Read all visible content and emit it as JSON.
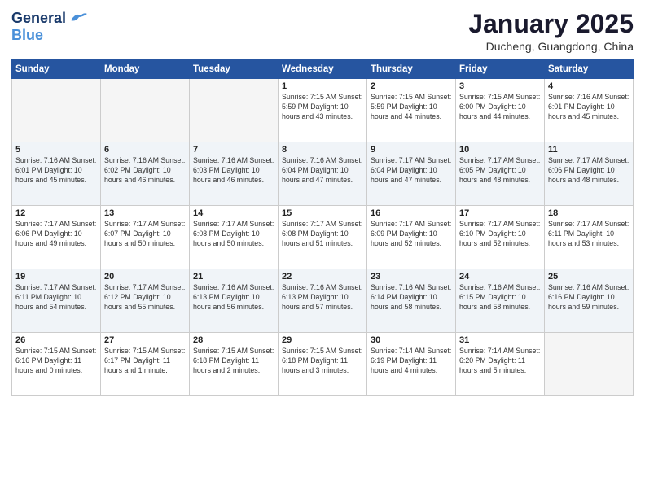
{
  "logo": {
    "line1": "General",
    "line2": "Blue"
  },
  "header": {
    "month": "January 2025",
    "location": "Ducheng, Guangdong, China"
  },
  "weekdays": [
    "Sunday",
    "Monday",
    "Tuesday",
    "Wednesday",
    "Thursday",
    "Friday",
    "Saturday"
  ],
  "weeks": [
    [
      {
        "day": "",
        "content": ""
      },
      {
        "day": "",
        "content": ""
      },
      {
        "day": "",
        "content": ""
      },
      {
        "day": "1",
        "content": "Sunrise: 7:15 AM\nSunset: 5:59 PM\nDaylight: 10 hours\nand 43 minutes."
      },
      {
        "day": "2",
        "content": "Sunrise: 7:15 AM\nSunset: 5:59 PM\nDaylight: 10 hours\nand 44 minutes."
      },
      {
        "day": "3",
        "content": "Sunrise: 7:15 AM\nSunset: 6:00 PM\nDaylight: 10 hours\nand 44 minutes."
      },
      {
        "day": "4",
        "content": "Sunrise: 7:16 AM\nSunset: 6:01 PM\nDaylight: 10 hours\nand 45 minutes."
      }
    ],
    [
      {
        "day": "5",
        "content": "Sunrise: 7:16 AM\nSunset: 6:01 PM\nDaylight: 10 hours\nand 45 minutes."
      },
      {
        "day": "6",
        "content": "Sunrise: 7:16 AM\nSunset: 6:02 PM\nDaylight: 10 hours\nand 46 minutes."
      },
      {
        "day": "7",
        "content": "Sunrise: 7:16 AM\nSunset: 6:03 PM\nDaylight: 10 hours\nand 46 minutes."
      },
      {
        "day": "8",
        "content": "Sunrise: 7:16 AM\nSunset: 6:04 PM\nDaylight: 10 hours\nand 47 minutes."
      },
      {
        "day": "9",
        "content": "Sunrise: 7:17 AM\nSunset: 6:04 PM\nDaylight: 10 hours\nand 47 minutes."
      },
      {
        "day": "10",
        "content": "Sunrise: 7:17 AM\nSunset: 6:05 PM\nDaylight: 10 hours\nand 48 minutes."
      },
      {
        "day": "11",
        "content": "Sunrise: 7:17 AM\nSunset: 6:06 PM\nDaylight: 10 hours\nand 48 minutes."
      }
    ],
    [
      {
        "day": "12",
        "content": "Sunrise: 7:17 AM\nSunset: 6:06 PM\nDaylight: 10 hours\nand 49 minutes."
      },
      {
        "day": "13",
        "content": "Sunrise: 7:17 AM\nSunset: 6:07 PM\nDaylight: 10 hours\nand 50 minutes."
      },
      {
        "day": "14",
        "content": "Sunrise: 7:17 AM\nSunset: 6:08 PM\nDaylight: 10 hours\nand 50 minutes."
      },
      {
        "day": "15",
        "content": "Sunrise: 7:17 AM\nSunset: 6:08 PM\nDaylight: 10 hours\nand 51 minutes."
      },
      {
        "day": "16",
        "content": "Sunrise: 7:17 AM\nSunset: 6:09 PM\nDaylight: 10 hours\nand 52 minutes."
      },
      {
        "day": "17",
        "content": "Sunrise: 7:17 AM\nSunset: 6:10 PM\nDaylight: 10 hours\nand 52 minutes."
      },
      {
        "day": "18",
        "content": "Sunrise: 7:17 AM\nSunset: 6:11 PM\nDaylight: 10 hours\nand 53 minutes."
      }
    ],
    [
      {
        "day": "19",
        "content": "Sunrise: 7:17 AM\nSunset: 6:11 PM\nDaylight: 10 hours\nand 54 minutes."
      },
      {
        "day": "20",
        "content": "Sunrise: 7:17 AM\nSunset: 6:12 PM\nDaylight: 10 hours\nand 55 minutes."
      },
      {
        "day": "21",
        "content": "Sunrise: 7:16 AM\nSunset: 6:13 PM\nDaylight: 10 hours\nand 56 minutes."
      },
      {
        "day": "22",
        "content": "Sunrise: 7:16 AM\nSunset: 6:13 PM\nDaylight: 10 hours\nand 57 minutes."
      },
      {
        "day": "23",
        "content": "Sunrise: 7:16 AM\nSunset: 6:14 PM\nDaylight: 10 hours\nand 58 minutes."
      },
      {
        "day": "24",
        "content": "Sunrise: 7:16 AM\nSunset: 6:15 PM\nDaylight: 10 hours\nand 58 minutes."
      },
      {
        "day": "25",
        "content": "Sunrise: 7:16 AM\nSunset: 6:16 PM\nDaylight: 10 hours\nand 59 minutes."
      }
    ],
    [
      {
        "day": "26",
        "content": "Sunrise: 7:15 AM\nSunset: 6:16 PM\nDaylight: 11 hours\nand 0 minutes."
      },
      {
        "day": "27",
        "content": "Sunrise: 7:15 AM\nSunset: 6:17 PM\nDaylight: 11 hours\nand 1 minute."
      },
      {
        "day": "28",
        "content": "Sunrise: 7:15 AM\nSunset: 6:18 PM\nDaylight: 11 hours\nand 2 minutes."
      },
      {
        "day": "29",
        "content": "Sunrise: 7:15 AM\nSunset: 6:18 PM\nDaylight: 11 hours\nand 3 minutes."
      },
      {
        "day": "30",
        "content": "Sunrise: 7:14 AM\nSunset: 6:19 PM\nDaylight: 11 hours\nand 4 minutes."
      },
      {
        "day": "31",
        "content": "Sunrise: 7:14 AM\nSunset: 6:20 PM\nDaylight: 11 hours\nand 5 minutes."
      },
      {
        "day": "",
        "content": ""
      }
    ]
  ]
}
